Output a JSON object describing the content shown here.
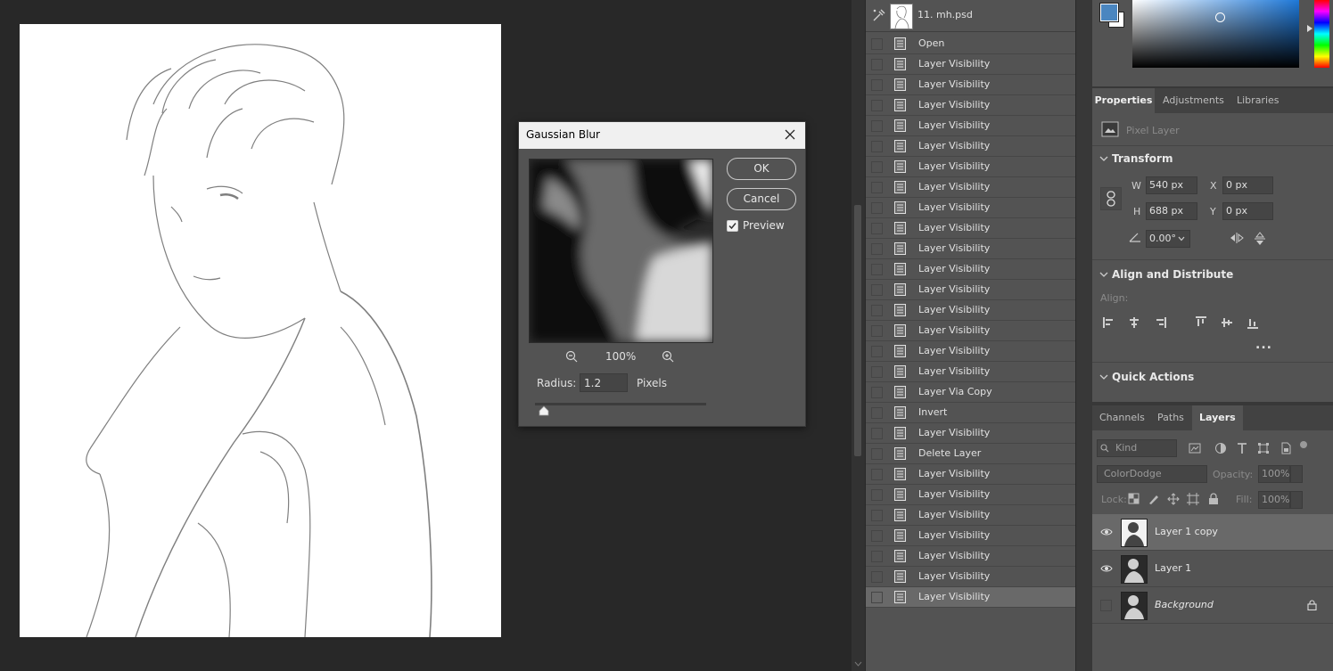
{
  "dialog": {
    "title": "Gaussian Blur",
    "ok_label": "OK",
    "cancel_label": "Cancel",
    "preview_label": "Preview",
    "preview_checked": true,
    "zoom": "100%",
    "radius_label": "Radius:",
    "radius_value": "1.2",
    "radius_unit": "Pixels"
  },
  "history": {
    "document": "11. mh.psd",
    "items": [
      "Open",
      "Layer Visibility",
      "Layer Visibility",
      "Layer Visibility",
      "Layer Visibility",
      "Layer Visibility",
      "Layer Visibility",
      "Layer Visibility",
      "Layer Visibility",
      "Layer Visibility",
      "Layer Visibility",
      "Layer Visibility",
      "Layer Visibility",
      "Layer Visibility",
      "Layer Visibility",
      "Layer Visibility",
      "Layer Visibility",
      "Layer Via Copy",
      "Invert",
      "Layer Visibility",
      "Delete Layer",
      "Layer Visibility",
      "Layer Visibility",
      "Layer Visibility",
      "Layer Visibility",
      "Layer Visibility",
      "Layer Visibility",
      "Layer Visibility"
    ]
  },
  "properties": {
    "tabs": [
      "Properties",
      "Adjustments",
      "Libraries"
    ],
    "pixel_layer_label": "Pixel Layer",
    "transform_title": "Transform",
    "w_label": "W",
    "w_value": "540 px",
    "h_label": "H",
    "h_value": "688 px",
    "x_label": "X",
    "x_value": "0 px",
    "y_label": "Y",
    "y_value": "0 px",
    "angle_value": "0.00°",
    "align_title": "Align and Distribute",
    "align_label": "Align:",
    "more_label": "...",
    "quick_actions_title": "Quick Actions"
  },
  "layers": {
    "tabs": [
      "Channels",
      "Paths",
      "Layers"
    ],
    "filter_placeholder": "Kind",
    "blend_mode": "ColorDodge",
    "opacity_label": "Opacity:",
    "opacity_value": "100%",
    "lock_label": "Lock:",
    "fill_label": "Fill:",
    "fill_value": "100%",
    "items": [
      {
        "name": "Layer 1 copy",
        "visible": true
      },
      {
        "name": "Layer 1",
        "visible": true
      },
      {
        "name": "Background",
        "visible": false
      }
    ]
  },
  "colors": {
    "foreground": "#4a86c0",
    "panel_bg": "#535353",
    "selected_row": "#696969"
  }
}
